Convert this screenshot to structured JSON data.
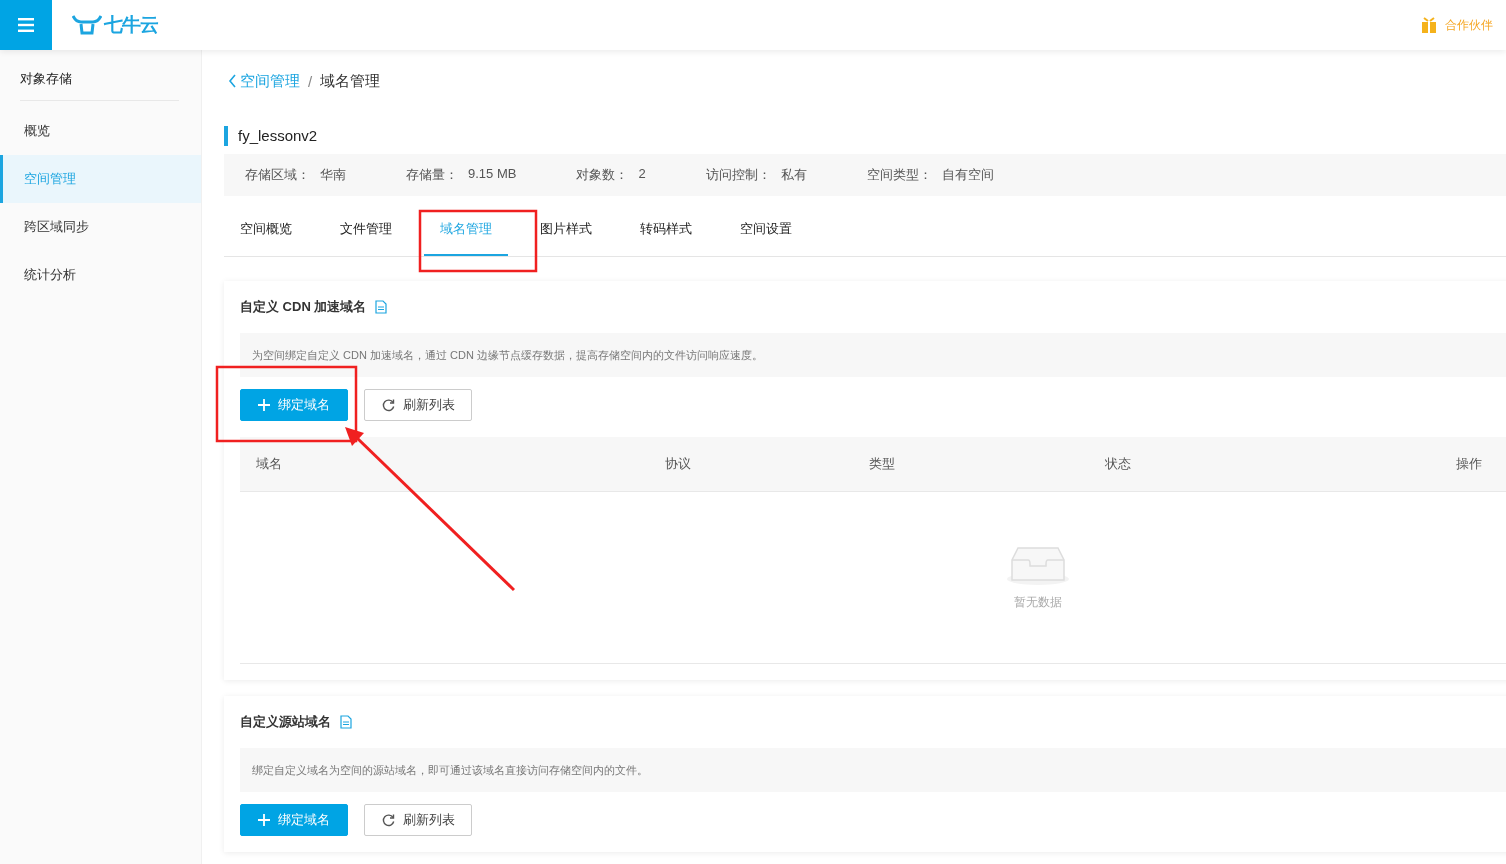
{
  "header": {
    "logo_text": "七牛云",
    "partner": "合作伙伴"
  },
  "sidebar": {
    "title": "对象存储",
    "items": [
      {
        "label": "概览",
        "selected": false
      },
      {
        "label": "空间管理",
        "selected": true
      },
      {
        "label": "跨区域同步",
        "selected": false
      },
      {
        "label": "统计分析",
        "selected": false
      }
    ]
  },
  "breadcrumb": {
    "back": "空间管理",
    "separator": "/",
    "current": "域名管理"
  },
  "bucket": {
    "name": "fy_lessonv2",
    "info": [
      {
        "label": "存储区域：",
        "value": "华南"
      },
      {
        "label": "存储量：",
        "value": "9.15 MB"
      },
      {
        "label": "对象数：",
        "value": "2"
      },
      {
        "label": "访问控制：",
        "value": "私有"
      },
      {
        "label": "空间类型：",
        "value": "自有空间"
      }
    ]
  },
  "tabs": [
    {
      "label": "空间概览",
      "selected": false
    },
    {
      "label": "文件管理",
      "selected": false
    },
    {
      "label": "域名管理",
      "selected": true
    },
    {
      "label": "图片样式",
      "selected": false
    },
    {
      "label": "转码样式",
      "selected": false
    },
    {
      "label": "空间设置",
      "selected": false
    }
  ],
  "sections": [
    {
      "title": "自定义 CDN 加速域名",
      "description": "为空间绑定自定义 CDN 加速域名，通过 CDN 边缘节点缓存数据，提高存储空间内的文件访问响应速度。",
      "buttons": [
        {
          "label": "绑定域名",
          "kind": "primary"
        },
        {
          "label": "刷新列表",
          "kind": "refresh"
        }
      ],
      "table": {
        "columns": [
          "域名",
          "协议",
          "类型",
          "状态",
          "操作"
        ],
        "empty_text": "暂无数据"
      }
    },
    {
      "title": "自定义源站域名",
      "description": "绑定自定义域名为空间的源站域名，即可通过该域名直接访问存储空间内的文件。",
      "buttons": [
        {
          "label": "绑定域名",
          "kind": "primary"
        },
        {
          "label": "刷新列表",
          "kind": "refresh"
        }
      ]
    }
  ]
}
